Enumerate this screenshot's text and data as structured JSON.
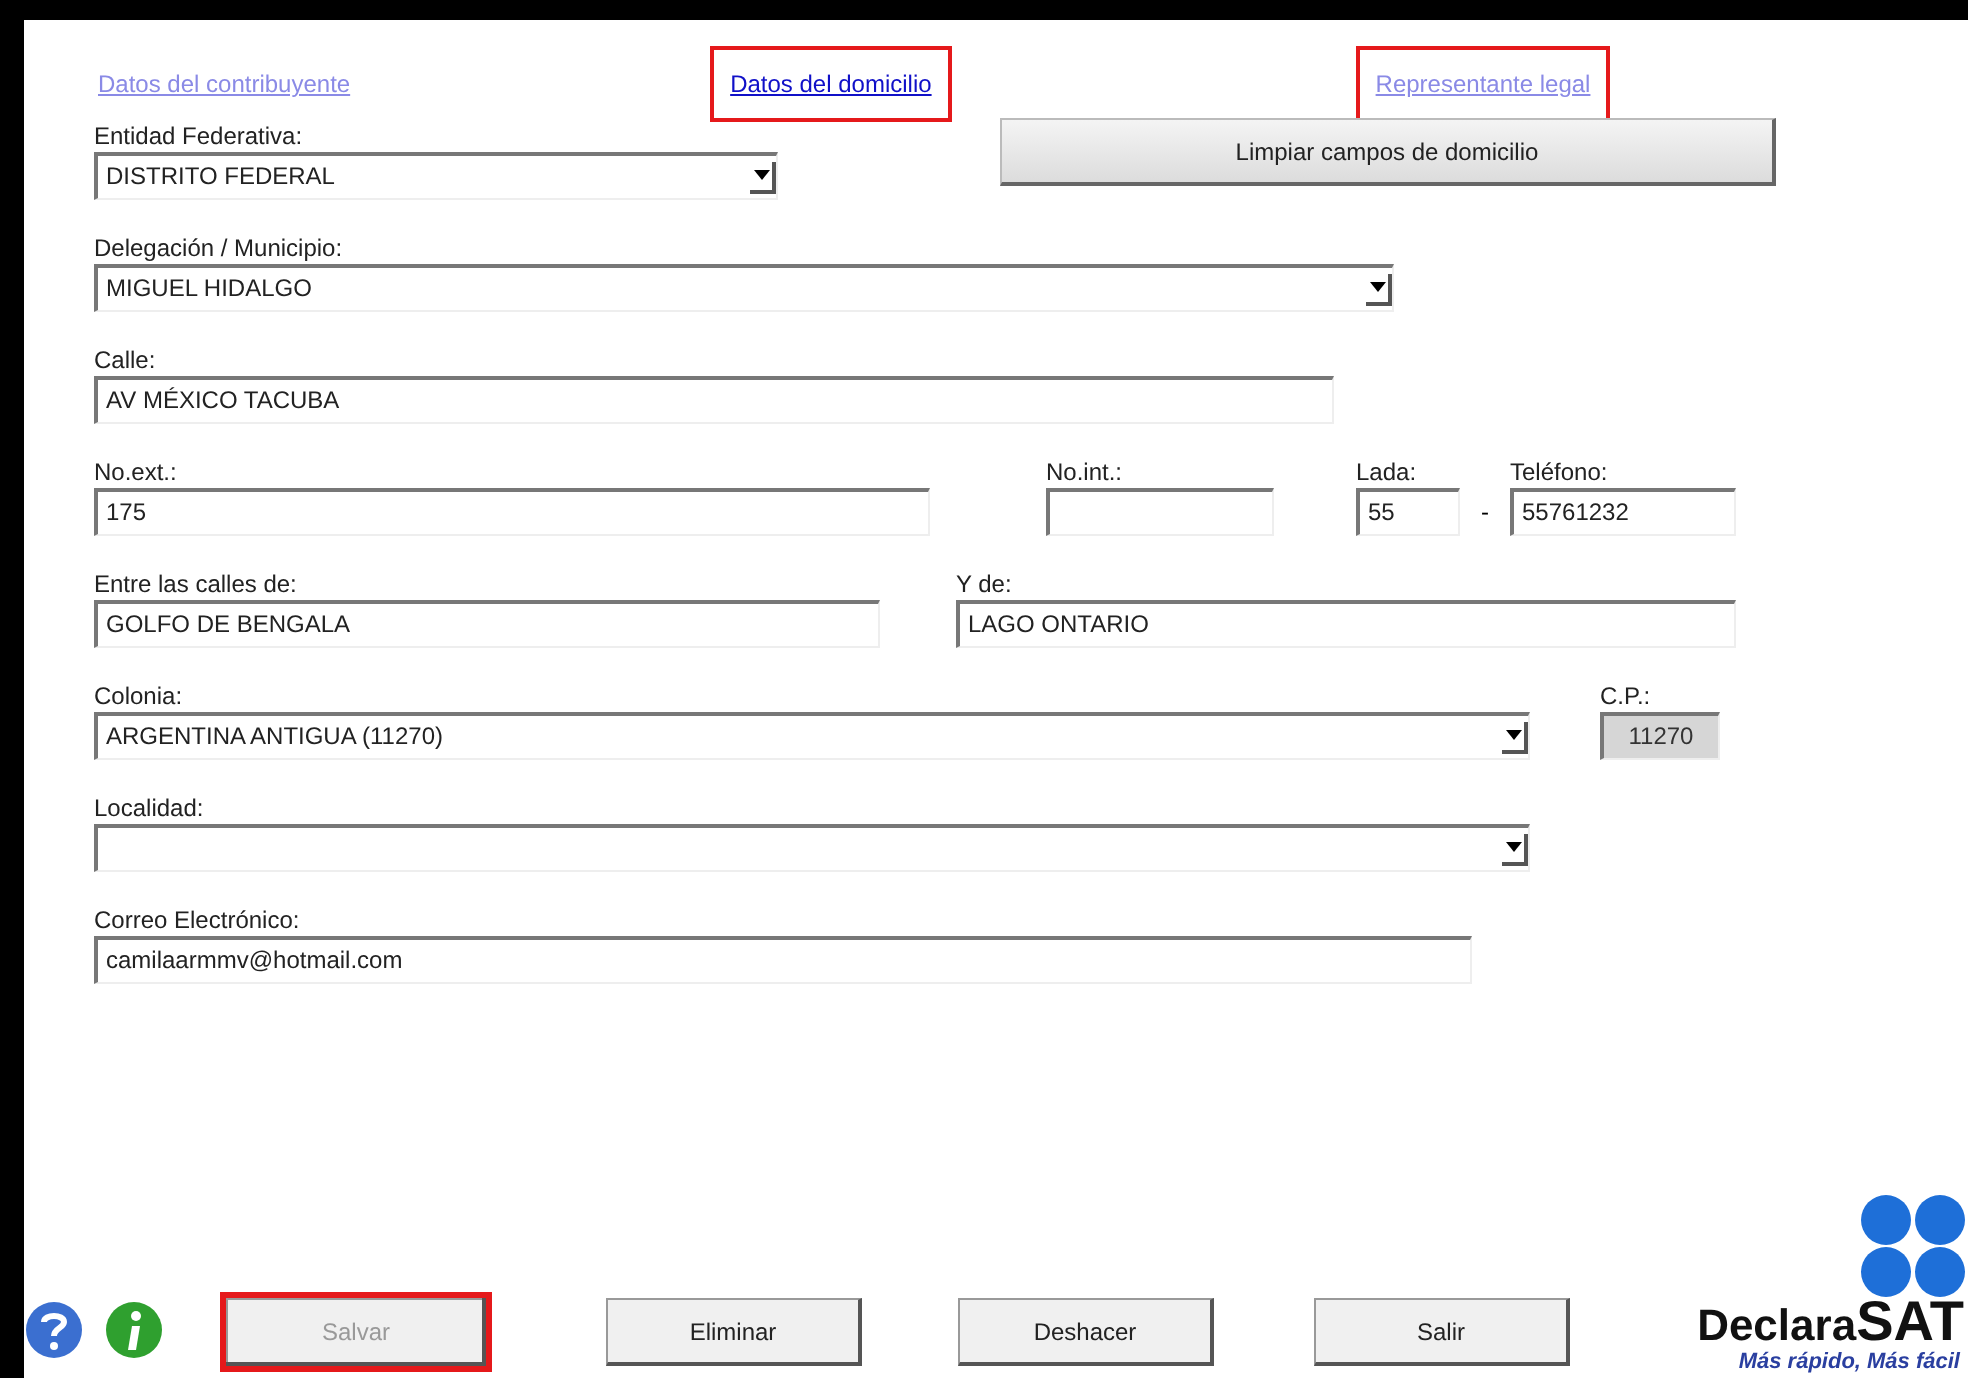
{
  "tabs": [
    {
      "label": "Datos del contribuyente",
      "selected": false,
      "highlighted": false
    },
    {
      "label": "Datos del domicilio",
      "selected": true,
      "highlighted": true
    },
    {
      "label": "Representante legal",
      "selected": false,
      "highlighted": true
    }
  ],
  "clear_button": {
    "label": "Limpiar campos de domicilio"
  },
  "fields": [
    {
      "kind": "combo",
      "label": "Entidad Federativa:",
      "value": "DISTRITO FEDERAL",
      "disabled": false
    },
    {
      "kind": "combo",
      "label": "Delegación / Municipio:",
      "value": "MIGUEL HIDALGO",
      "disabled": false
    },
    {
      "kind": "text",
      "label": "Calle:",
      "value": "AV MÉXICO TACUBA",
      "disabled": false
    },
    {
      "kind": "text",
      "label": "No.ext.:",
      "value": "175",
      "disabled": false
    },
    {
      "kind": "text",
      "label": "No.int.:",
      "disabled": false
    },
    {
      "kind": "text",
      "label": "Lada:",
      "value": "55",
      "disabled": false
    },
    {
      "kind": "separator",
      "value": "-"
    },
    {
      "kind": "text",
      "label": "Teléfono:",
      "value": "55761232",
      "disabled": false
    },
    {
      "kind": "text",
      "label": "Entre las calles de:",
      "value": "GOLFO DE BENGALA",
      "disabled": false
    },
    {
      "kind": "text",
      "label": "Y de:",
      "value": "LAGO ONTARIO",
      "disabled": false
    },
    {
      "kind": "combo",
      "label": "Colonia:",
      "value": "ARGENTINA ANTIGUA (11270)",
      "disabled": false
    },
    {
      "kind": "text",
      "label": "C.P.:",
      "value": "11270",
      "disabled": true
    },
    {
      "kind": "combo",
      "label": "Localidad:",
      "disabled": false
    },
    {
      "kind": "text",
      "label": "Correo Electrónico:",
      "value": "camilaarmmv@hotmail.com",
      "disabled": false
    }
  ],
  "buttons": [
    {
      "label": "Salvar",
      "disabled": true,
      "highlighted": true
    },
    {
      "label": "Eliminar",
      "disabled": false,
      "highlighted": false
    },
    {
      "label": "Deshacer",
      "disabled": false,
      "highlighted": false
    },
    {
      "label": "Salir",
      "disabled": false,
      "highlighted": false
    }
  ],
  "logo": {
    "name": "Declara**SAT**",
    "slogan": "Más rápido, Más fácil"
  }
}
